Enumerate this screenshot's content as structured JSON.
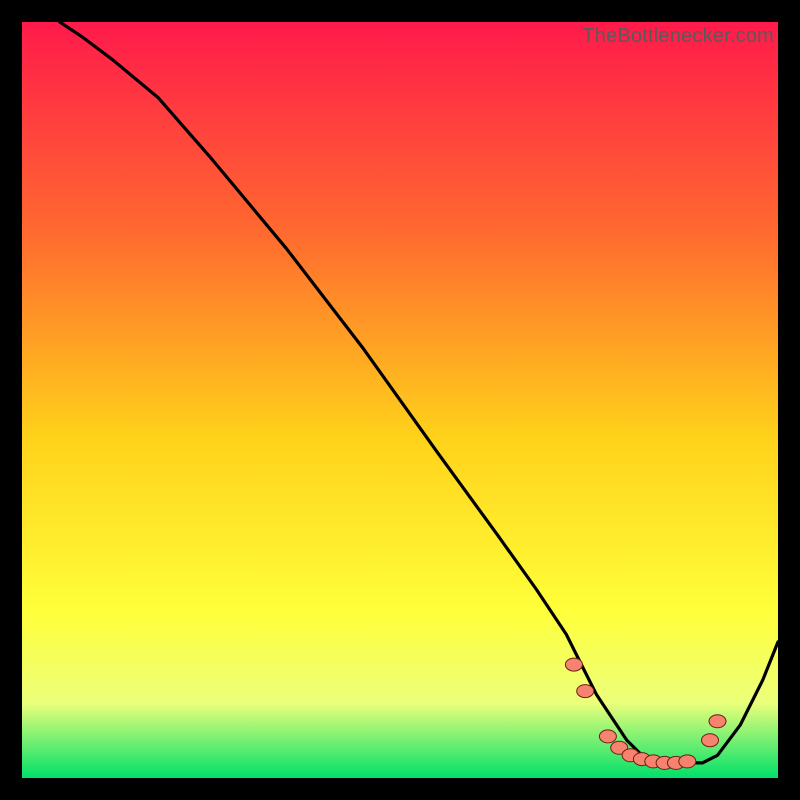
{
  "watermark": "TheBottlenecker.com",
  "colors": {
    "gradient_top": "#ff1a4b",
    "gradient_mid_upper": "#ff6a2f",
    "gradient_mid": "#ffd21a",
    "gradient_mid_lower": "#ffff3a",
    "gradient_lower": "#ecff7a",
    "gradient_bottom": "#00e06a",
    "curve": "#000000",
    "dot_fill": "#f7826e",
    "dot_stroke": "#6b2016"
  },
  "chart_data": {
    "type": "line",
    "title": "",
    "xlabel": "",
    "ylabel": "",
    "xlim": [
      0,
      100
    ],
    "ylim": [
      0,
      100
    ],
    "series": [
      {
        "name": "bottleneck-curve",
        "x": [
          5,
          8,
          12,
          18,
          25,
          35,
          45,
          55,
          63,
          68,
          72,
          74,
          76,
          78,
          80,
          82,
          84,
          86,
          88,
          90,
          92,
          95,
          98,
          100
        ],
        "y": [
          100,
          98,
          95,
          90,
          82,
          70,
          57,
          43,
          32,
          25,
          19,
          15,
          11,
          8,
          5,
          3,
          2,
          2,
          2,
          2,
          3,
          7,
          13,
          18
        ]
      }
    ],
    "dots": [
      {
        "x": 73.0,
        "y": 15.0
      },
      {
        "x": 74.5,
        "y": 11.5
      },
      {
        "x": 77.5,
        "y": 5.5
      },
      {
        "x": 79.0,
        "y": 4.0
      },
      {
        "x": 80.5,
        "y": 3.0
      },
      {
        "x": 82.0,
        "y": 2.5
      },
      {
        "x": 83.5,
        "y": 2.2
      },
      {
        "x": 85.0,
        "y": 2.0
      },
      {
        "x": 86.5,
        "y": 2.0
      },
      {
        "x": 88.0,
        "y": 2.2
      },
      {
        "x": 91.0,
        "y": 5.0
      },
      {
        "x": 92.0,
        "y": 7.5
      }
    ]
  }
}
